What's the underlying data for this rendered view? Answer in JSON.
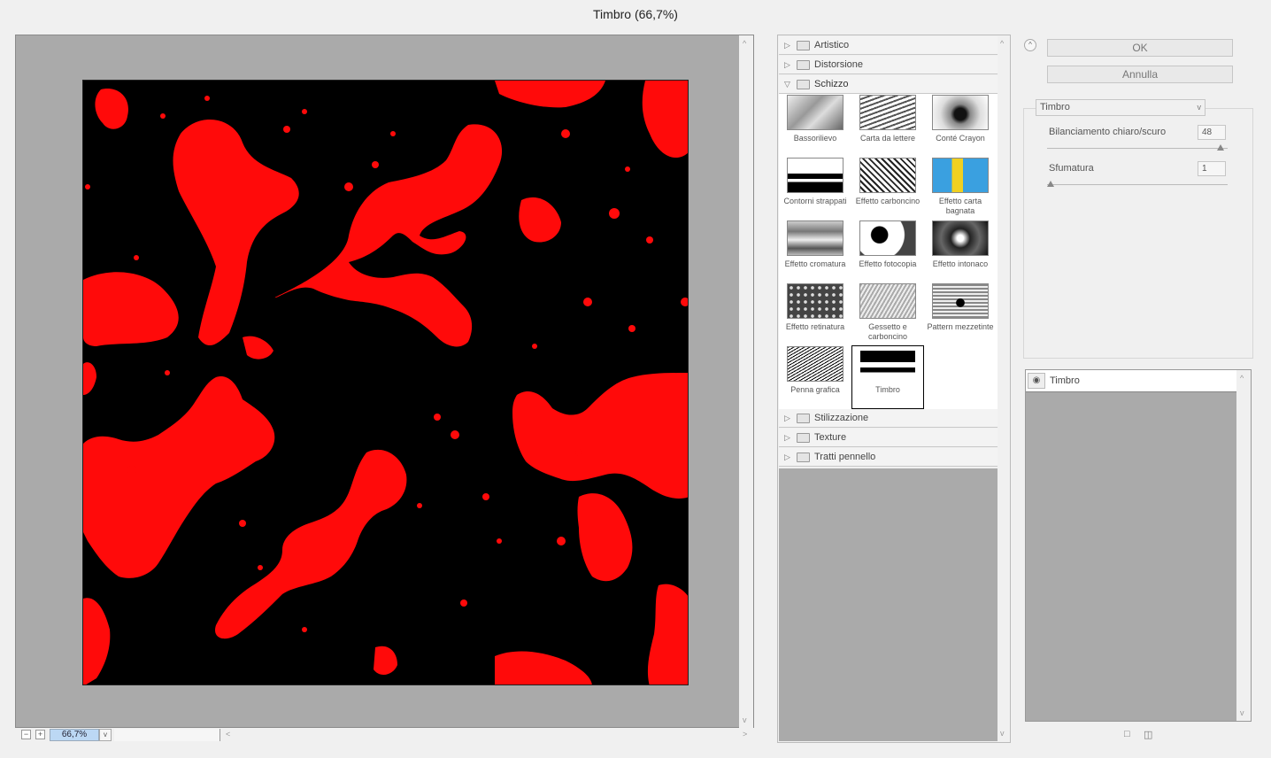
{
  "window": {
    "title": "Timbro (66,7%)"
  },
  "zoom": {
    "value": "66,7%",
    "minus": "−",
    "plus": "+"
  },
  "filter_groups": {
    "artistico": "Artistico",
    "distorsione": "Distorsione",
    "schizzo": "Schizzo",
    "stilizzazione": "Stilizzazione",
    "texture": "Texture",
    "tratti_pennello": "Tratti pennello"
  },
  "filters": [
    "Bassorilievo",
    "Carta da lettere",
    "Conté Crayon",
    "Contorni strappati",
    "Effetto carboncino",
    "Effetto carta bagnata",
    "Effetto cromatura",
    "Effetto fotocopia",
    "Effetto intonaco",
    "Effetto retinatura",
    "Gessetto e carboncino",
    "Pattern mezzetinte",
    "Penna grafica",
    "Timbro"
  ],
  "selected_filter": "Timbro",
  "buttons": {
    "ok": "OK",
    "cancel": "Annulla"
  },
  "settings": {
    "filter_select": "Timbro",
    "param1_label": "Bilanciamento chiaro/scuro",
    "param1_value": "48",
    "param1_level": 0.96,
    "param2_label": "Sfumatura",
    "param2_value": "1",
    "param2_level": 0.02
  },
  "layers": {
    "layer_name": "Timbro"
  },
  "colors": {
    "preview_bg": "#000000",
    "blob": "#ff0a0a",
    "canvas_bg": "#aaaaaa",
    "zoom_highlight": "#bcd8f4"
  }
}
